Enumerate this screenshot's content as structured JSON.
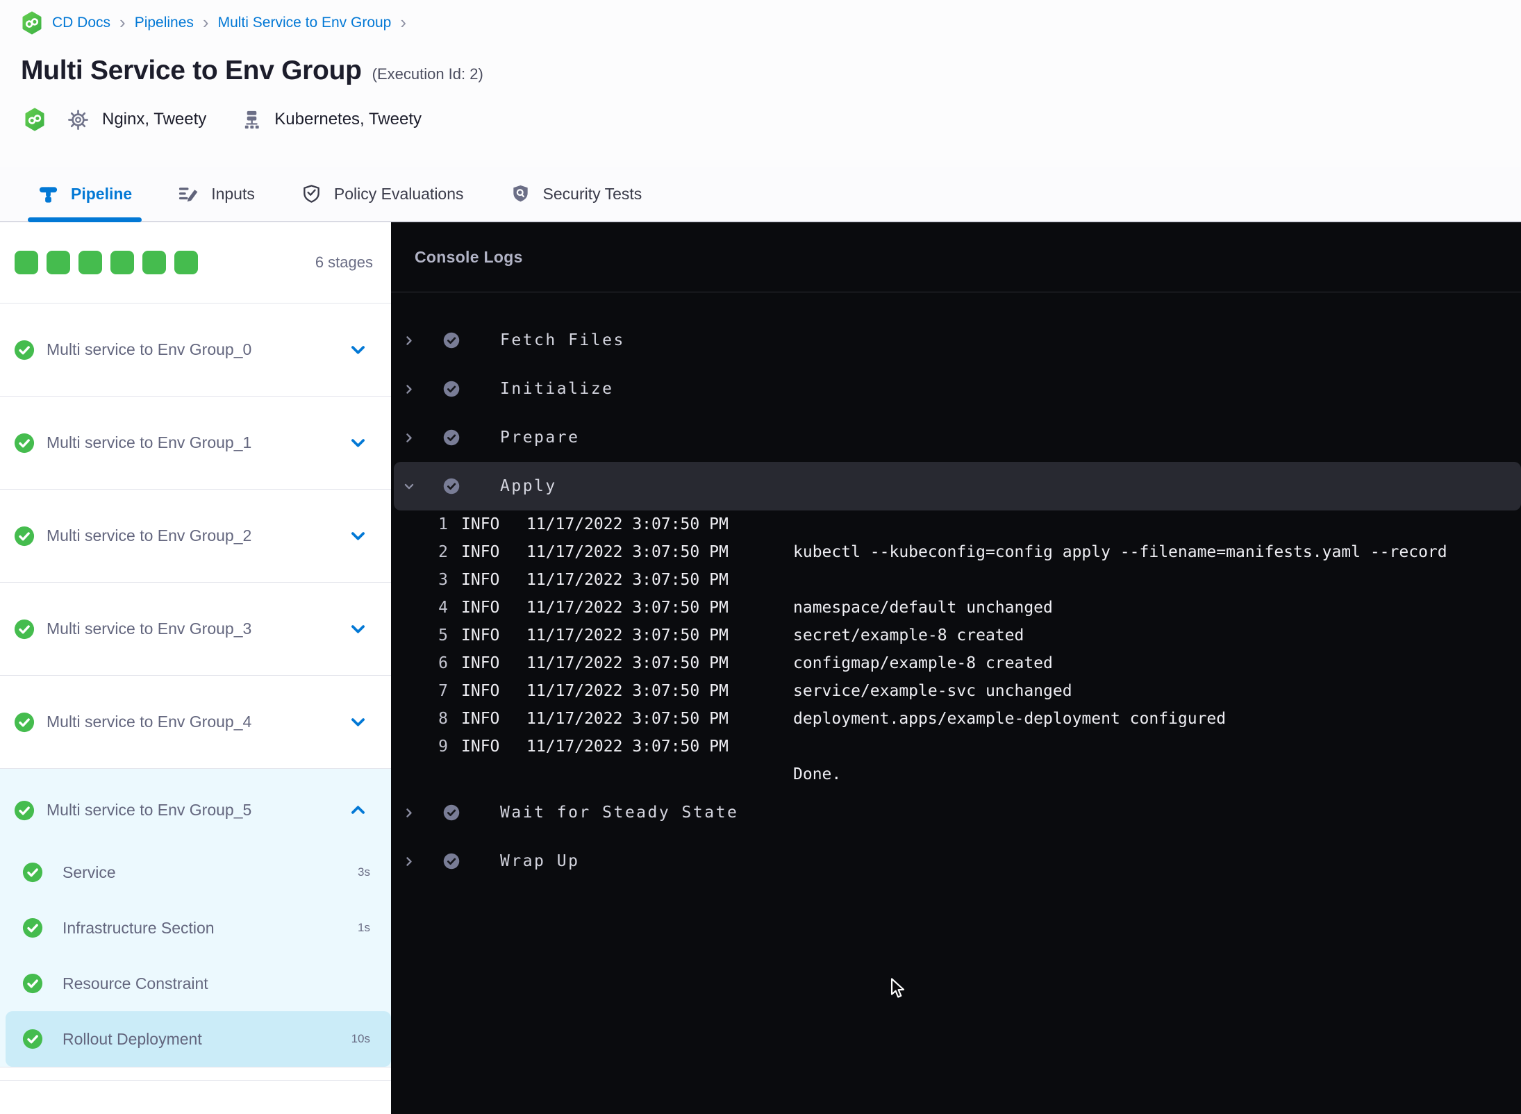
{
  "colors": {
    "green": "#45BC4E",
    "blue": "#0278D5",
    "console_bg": "#0A0B0E",
    "selected_step_bg": "#CBECF8",
    "expanded_stage_bg": "#ECF9FE"
  },
  "breadcrumb": {
    "logo_icon": "harness-cd-logo",
    "items": [
      "CD Docs",
      "Pipelines",
      "Multi Service to Env Group"
    ],
    "separator": "›"
  },
  "header": {
    "title": "Multi Service to Env Group",
    "execution_id": "(Execution Id: 2)",
    "services_label": "Nginx, Tweety",
    "environments_label": "Kubernetes, Tweety"
  },
  "tabs": [
    {
      "label": "Pipeline",
      "icon": "pipeline-icon",
      "active": true
    },
    {
      "label": "Inputs",
      "icon": "inputs-icon",
      "active": false
    },
    {
      "label": "Policy Evaluations",
      "icon": "shield-check-icon",
      "active": false
    },
    {
      "label": "Security Tests",
      "icon": "shield-search-icon",
      "active": false
    }
  ],
  "sidebar": {
    "stages_summary": "6 stages",
    "progress_squares": 6,
    "stages": [
      {
        "label": "Multi service to Env Group_0",
        "status": "success",
        "expanded": false
      },
      {
        "label": "Multi service to Env Group_1",
        "status": "success",
        "expanded": false
      },
      {
        "label": "Multi service to Env Group_2",
        "status": "success",
        "expanded": false
      },
      {
        "label": "Multi service to Env Group_3",
        "status": "success",
        "expanded": false
      },
      {
        "label": "Multi service to Env Group_4",
        "status": "success",
        "expanded": false
      },
      {
        "label": "Multi service to Env Group_5",
        "status": "success",
        "expanded": true,
        "steps": [
          {
            "label": "Service",
            "duration": "3s",
            "status": "success",
            "selected": false
          },
          {
            "label": "Infrastructure Section",
            "duration": "1s",
            "status": "success",
            "selected": false
          },
          {
            "label": "Resource Constraint",
            "duration": "",
            "status": "success",
            "selected": false
          },
          {
            "label": "Rollout Deployment",
            "duration": "10s",
            "status": "success",
            "selected": true
          }
        ]
      }
    ]
  },
  "console": {
    "title": "Console Logs",
    "steps": [
      {
        "label": "Fetch Files",
        "status": "success",
        "expanded": false
      },
      {
        "label": "Initialize",
        "status": "success",
        "expanded": false
      },
      {
        "label": "Prepare",
        "status": "success",
        "expanded": false
      },
      {
        "label": "Apply",
        "status": "success",
        "expanded": true,
        "logs": [
          {
            "num": "1",
            "level": "INFO",
            "time": "11/17/2022 3:07:50 PM",
            "message": ""
          },
          {
            "num": "2",
            "level": "INFO",
            "time": "11/17/2022 3:07:50 PM",
            "message": "kubectl --kubeconfig=config apply --filename=manifests.yaml --record"
          },
          {
            "num": "3",
            "level": "INFO",
            "time": "11/17/2022 3:07:50 PM",
            "message": ""
          },
          {
            "num": "4",
            "level": "INFO",
            "time": "11/17/2022 3:07:50 PM",
            "message": "namespace/default unchanged"
          },
          {
            "num": "5",
            "level": "INFO",
            "time": "11/17/2022 3:07:50 PM",
            "message": "secret/example-8 created"
          },
          {
            "num": "6",
            "level": "INFO",
            "time": "11/17/2022 3:07:50 PM",
            "message": "configmap/example-8 created"
          },
          {
            "num": "7",
            "level": "INFO",
            "time": "11/17/2022 3:07:50 PM",
            "message": "service/example-svc unchanged"
          },
          {
            "num": "8",
            "level": "INFO",
            "time": "11/17/2022 3:07:50 PM",
            "message": "deployment.apps/example-deployment configured"
          },
          {
            "num": "9",
            "level": "INFO",
            "time": "11/17/2022 3:07:50 PM",
            "message": ""
          },
          {
            "num": "",
            "level": "",
            "time": "",
            "message": "Done."
          }
        ]
      },
      {
        "label": "Wait for Steady State",
        "status": "success",
        "expanded": false
      },
      {
        "label": "Wrap Up",
        "status": "success",
        "expanded": false
      }
    ]
  }
}
